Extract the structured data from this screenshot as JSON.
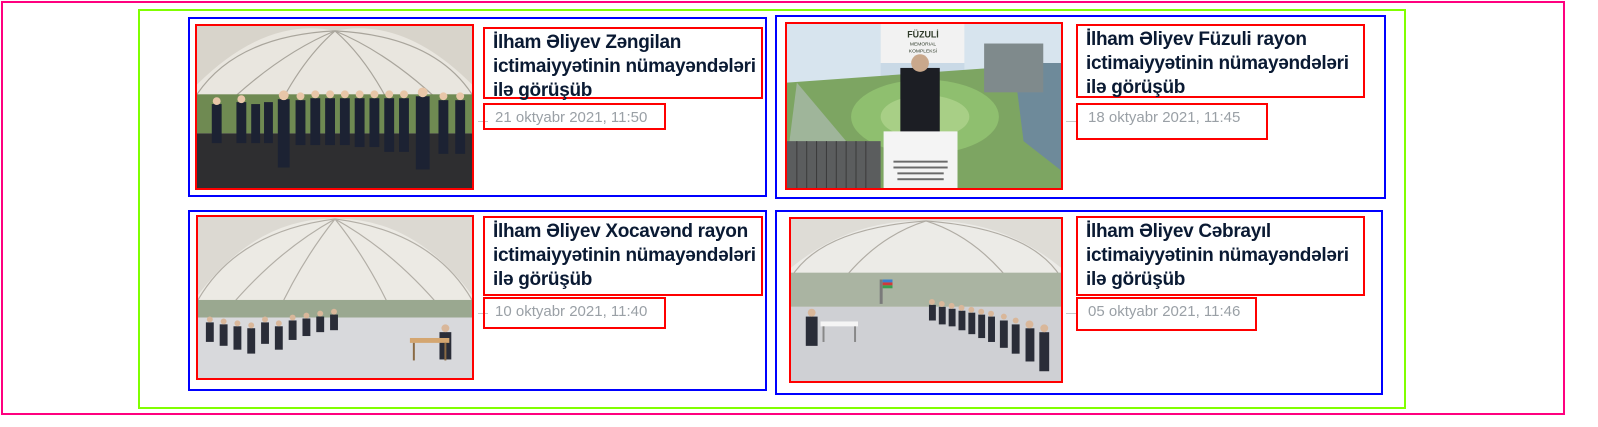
{
  "articles": [
    {
      "title_lines": [
        "İlham Əliyev Zəngilan",
        "ictimaiyyətinin nümayəndələri",
        "ilə görüşüb"
      ],
      "date": "21 oktyabr 2021, 11:50"
    },
    {
      "title_lines": [
        "İlham Əliyev Füzuli rayon",
        "ictimaiyyətinin nümayəndələri",
        "ilə görüşüb"
      ],
      "date": "18 oktyabr 2021, 11:45",
      "photo_sign": [
        "FÜZULİ",
        "MEMORIAL",
        "KOMPLEKSİ"
      ]
    },
    {
      "title_lines": [
        "İlham Əliyev Xocavənd rayon",
        "ictimaiyyətinin nümayəndələri",
        "ilə görüşüb"
      ],
      "date": "10 oktyabr 2021, 11:40"
    },
    {
      "title_lines": [
        "İlham Əliyev Cəbrayıl",
        "ictimaiyyətinin nümayəndələri",
        "ilə görüşüb"
      ],
      "date": "05 oktyabr 2021, 11:46"
    }
  ],
  "colors": {
    "outer_frame": "#ff007f",
    "grid_frame": "#80ff00",
    "card_frame": "#0000ff",
    "element_frame": "#ff0000",
    "title_text": "#0a1a33",
    "date_text": "#9aa0a6"
  }
}
